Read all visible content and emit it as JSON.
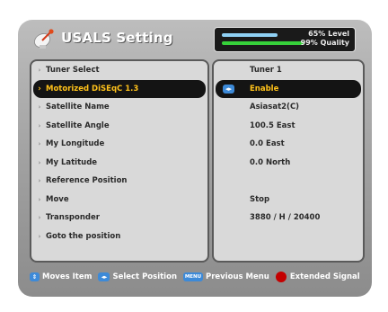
{
  "header": {
    "title": "USALS Setting",
    "icon": "satellite-dish-icon",
    "signal": {
      "level_text": "65% Level",
      "quality_text": "99% Quality",
      "level_percent": 65,
      "quality_percent": 99
    }
  },
  "menu": {
    "items": [
      {
        "label": "Tuner Select",
        "value": "Tuner 1"
      },
      {
        "label": "Motorized DiSEqC 1.3",
        "value": "Enable"
      },
      {
        "label": "Satellite Name",
        "value": "Asiasat2(C)"
      },
      {
        "label": "Satellite Angle",
        "value": "100.5 East"
      },
      {
        "label": "My Longitude",
        "value": "0.0 East"
      },
      {
        "label": "My Latitude",
        "value": "0.0 North"
      },
      {
        "label": "Reference Position",
        "value": ""
      },
      {
        "label": "Move",
        "value": "Stop"
      },
      {
        "label": "Transponder",
        "value": "3880 / H / 20400"
      },
      {
        "label": "Goto the position",
        "value": ""
      }
    ],
    "selected_index": 1
  },
  "help": {
    "moves_item": "Moves Item",
    "select_position": "Select Position",
    "menu_key": "MENU",
    "previous_menu": "Previous Menu",
    "extended_signal": "Extended Signal"
  },
  "colors": {
    "highlight_bg": "#141414",
    "highlight_text": "#ffc21a",
    "level_bar": "#8fd0f4",
    "quality_bar": "#36d13a",
    "red_key": "#c40000"
  }
}
